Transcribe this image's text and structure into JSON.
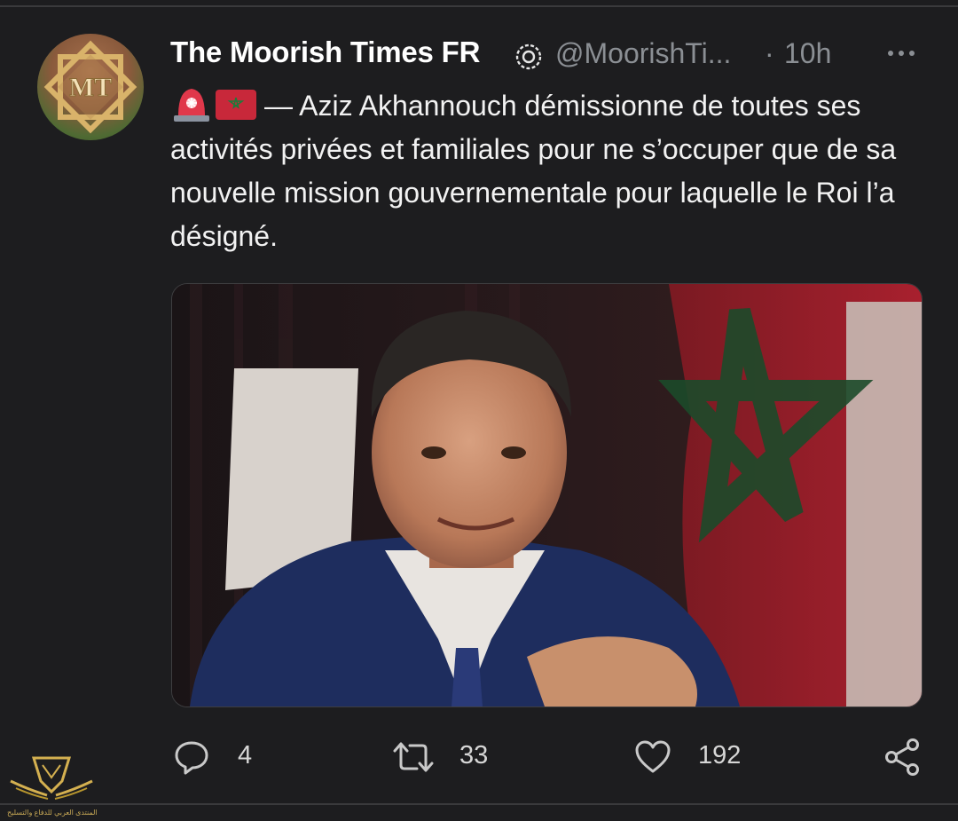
{
  "tweet": {
    "author_name": "The Moorish Times FR",
    "handle": "@MoorishTi...",
    "separator": "·",
    "time": "10h",
    "avatar_letters": "MT",
    "text": "— Aziz Akhannouch démissionne de toutes ses activités privées et familiales pour ne s’occuper que de sa nouvelle mission gouvernementale pour laquelle le Roi l’a désigné.",
    "emojis": [
      "rotating-light-icon",
      "morocco-flag-icon"
    ]
  },
  "actions": {
    "reply_count": "4",
    "retweet_count": "33",
    "like_count": "192"
  },
  "watermark": {
    "text": "المنتدى العربي للدفاع والتسليح"
  },
  "colors": {
    "background": "#1d1d1f",
    "muted": "#8b8f94",
    "text": "#f2f2f2"
  }
}
